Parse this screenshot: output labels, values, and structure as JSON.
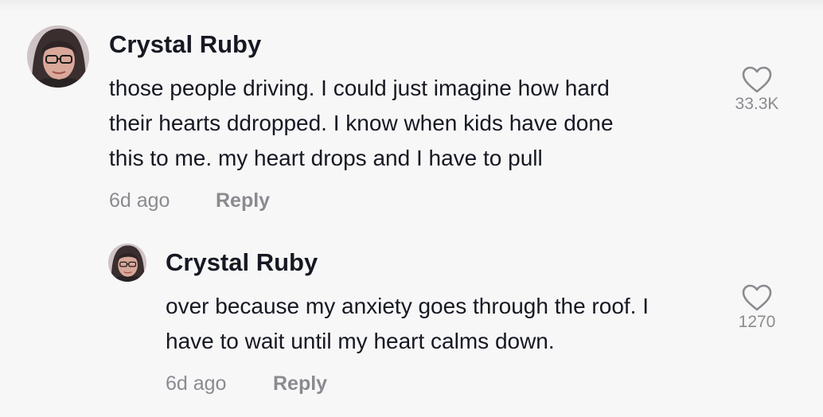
{
  "comments": [
    {
      "username": "Crystal Ruby",
      "text": "those people driving. I could just imagine how hard\ntheir hearts ddropped. I know when kids have done\nthis to me. my heart drops and I have to pull",
      "time": "6d ago",
      "reply_label": "Reply",
      "likes": "33.3K",
      "like_icon": "heart-outline-icon",
      "avatar_icon": "profile-photo-avatar"
    },
    {
      "username": "Crystal Ruby",
      "text": "over because my anxiety goes through the roof. I\nhave to wait until my heart calms down.",
      "time": "6d ago",
      "reply_label": "Reply",
      "likes": "1270",
      "like_icon": "heart-outline-icon",
      "avatar_icon": "profile-photo-avatar"
    }
  ],
  "colors": {
    "background": "#f7f7f7",
    "primary_text": "#161823",
    "secondary_text": "#8a8b91"
  }
}
